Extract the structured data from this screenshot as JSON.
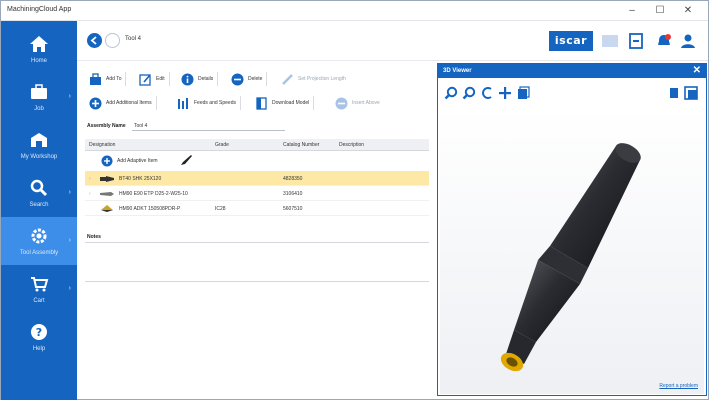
{
  "window": {
    "title": "MachiningCloud App"
  },
  "sidebar": {
    "items": [
      {
        "label": "Home",
        "icon": "home-icon"
      },
      {
        "label": "Job",
        "icon": "briefcase-icon"
      },
      {
        "label": "My Workshop",
        "icon": "workshop-icon"
      },
      {
        "label": "Search",
        "icon": "search-icon"
      },
      {
        "label": "Tool Assembly",
        "icon": "gear-icon",
        "active": true
      },
      {
        "label": "Cart",
        "icon": "cart-icon"
      },
      {
        "label": "Help",
        "icon": "help-icon"
      }
    ]
  },
  "header": {
    "tab_name": "Tool 4",
    "brand": "iscar"
  },
  "toolbar": {
    "row1": [
      {
        "label": "Add To",
        "icon": "add-to-icon"
      },
      {
        "label": "Edit",
        "icon": "edit-icon"
      },
      {
        "label": "Details",
        "icon": "info-icon"
      },
      {
        "label": "Delete",
        "icon": "delete-icon"
      },
      {
        "label": "Set Projection Length",
        "icon": "ruler-icon",
        "disabled": true
      }
    ],
    "row2": [
      {
        "label": "Add Additional Items",
        "icon": "plus-circle-icon"
      },
      {
        "label": "Feeds and Speeds",
        "icon": "feeds-icon"
      },
      {
        "label": "Download Model",
        "icon": "download-icon"
      },
      {
        "label": "Insert Above",
        "icon": "insert-icon",
        "disabled": true
      }
    ]
  },
  "assembly": {
    "label": "Assembly Name",
    "value": "Tool 4"
  },
  "grid": {
    "columns": [
      "Designation",
      "Grade",
      "Catalog Number",
      "Description"
    ],
    "add_row_label": "Add Adaptive Item",
    "rows": [
      {
        "designation": "BT40 SHK 25X120",
        "grade": "",
        "catalog": "4828350",
        "selected": true
      },
      {
        "designation": "HM90 E90 ETP D25-2-W25-10",
        "grade": "",
        "catalog": "3106410",
        "selected": false
      },
      {
        "designation": "HM90 ADKT 150508PDR-P",
        "grade": "IC28",
        "catalog": "5607510",
        "selected": false
      }
    ]
  },
  "notes": {
    "label": "Notes"
  },
  "viewer": {
    "title": "3D Viewer",
    "report_link": "Report a problem"
  },
  "colors": {
    "brand_blue": "#1565c0",
    "selected_row": "#fde9a5",
    "sidebar_active": "#3d8ee8"
  }
}
